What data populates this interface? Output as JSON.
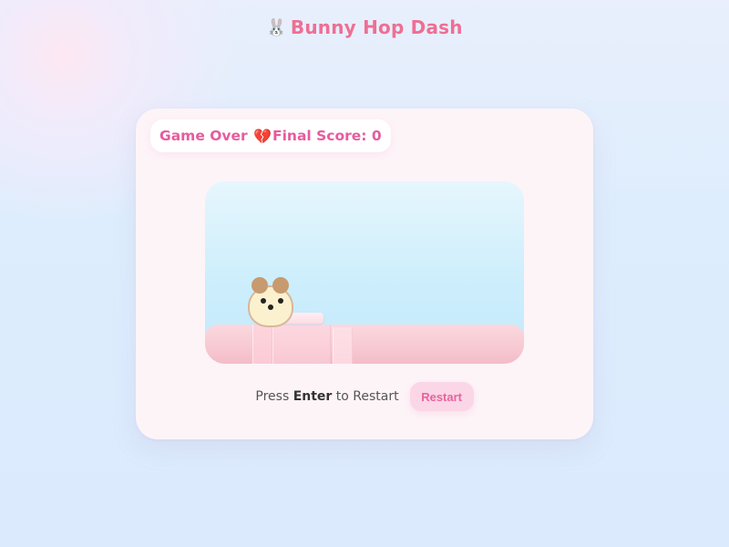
{
  "header": {
    "icon": "bunny-icon",
    "icon_glyph": "🐰",
    "title": "Bunny Hop Dash"
  },
  "status": {
    "game_over": "Game Over",
    "heart_icon": "broken-heart-icon",
    "heart_glyph": "💔",
    "score_label": "Final Score: 0",
    "score": 0
  },
  "controls": {
    "hint_prefix": "Press",
    "hint_key": "Enter",
    "hint_suffix": "to Restart",
    "restart_label": "Restart"
  },
  "colors": {
    "accent": "#ee6f93",
    "status_text": "#e65c9e",
    "ground": "#f7c9d2",
    "sky": "#cdeefc",
    "button_bg": "#fbd6e6"
  }
}
